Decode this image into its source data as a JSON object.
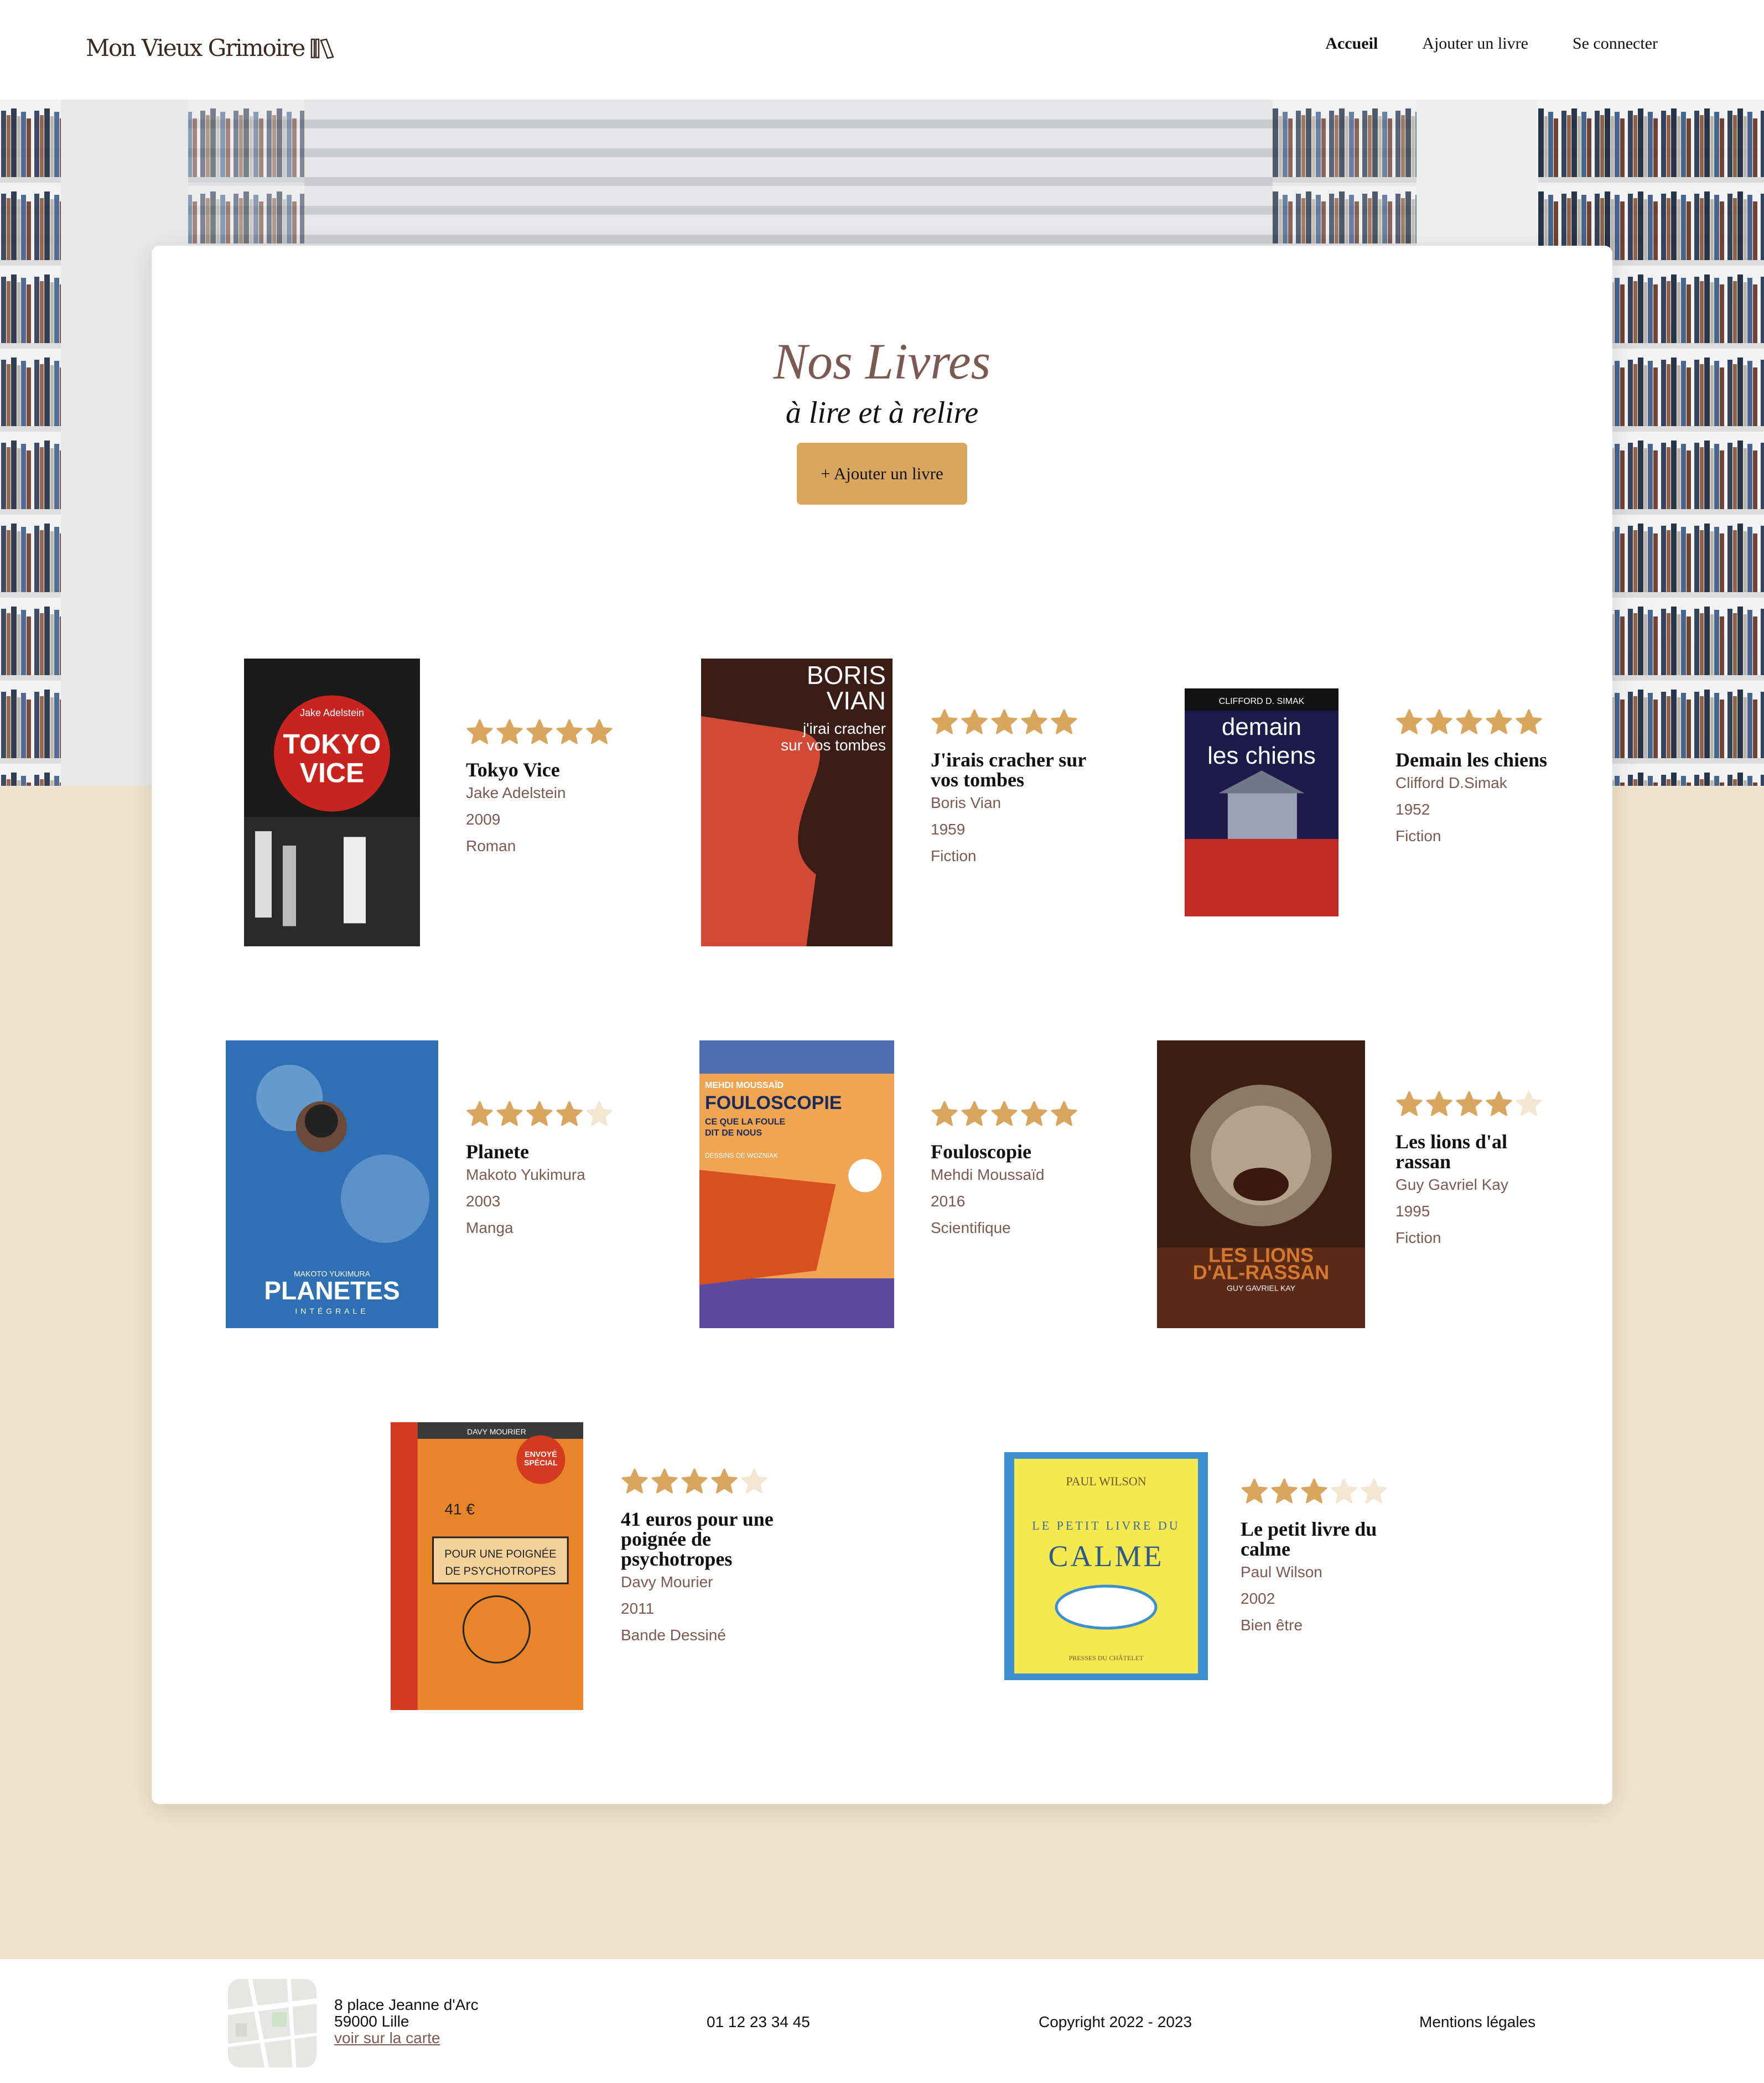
{
  "header": {
    "logo_text": "Mon Vieux Grimoire",
    "nav": [
      "Accueil",
      "Ajouter un livre",
      "Se connecter"
    ]
  },
  "main": {
    "title": "Nos Livres",
    "subtitle": "à lire et à relire",
    "add_button": "+ Ajouter un livre"
  },
  "colors": {
    "accent": "#d9a65f",
    "star_on": "#d9a65f",
    "star_off": "#f3e6d3",
    "muted_text": "#7a5a52",
    "page_bg": "#f1e3cd"
  },
  "books": [
    {
      "title": "Tokyo Vice",
      "author": "Jake Adelstein",
      "year": "2009",
      "genre": "Roman",
      "rating": 5,
      "cover": {
        "bg": "#1a1a1a",
        "accent": "#c9231f",
        "texts": [
          "Jake Adelstein",
          "TOKYO VICE"
        ]
      }
    },
    {
      "title": "J'irais cracher sur vos tombes",
      "author": "Boris Vian",
      "year": "1959",
      "genre": "Fiction",
      "rating": 5,
      "cover": {
        "bg": "#3a1d17",
        "accent": "#d24a35",
        "texts": [
          "BORIS VIAN",
          "j'irai cracher sur vos tombes"
        ]
      }
    },
    {
      "title": "Demain les chiens",
      "author": "Clifford D.Simak",
      "year": "1952",
      "genre": "Fiction",
      "rating": 5,
      "cover": {
        "bg": "#1d1a4a",
        "accent": "#c22a22",
        "texts": [
          "CLIFFORD D. SIMAK",
          "demain les chiens"
        ]
      }
    },
    {
      "title": "Planete",
      "author": "Makoto Yukimura",
      "year": "2003",
      "genre": "Manga",
      "rating": 4,
      "cover": {
        "bg": "#2f6fb3",
        "accent": "#9bc7ea",
        "texts": [
          "MAKOTO YUKIMURA",
          "PLANETES",
          "INTÉGRALE"
        ]
      }
    },
    {
      "title": "Fouloscopie",
      "author": "Mehdi Moussaïd",
      "year": "2016",
      "genre": "Scientifique",
      "rating": 5,
      "cover": {
        "bg": "#f0a552",
        "accent": "#d8501f",
        "texts": [
          "MEHDI MOUSSAÏD",
          "FOULOSCOPIE",
          "CE QUE LA FOULE DIT DE NOUS",
          "DESSINS DE WOZNIAK"
        ]
      }
    },
    {
      "title": "Les lions d'al rassan",
      "author": "Guy Gavriel Kay",
      "year": "1995",
      "genre": "Fiction",
      "rating": 4,
      "cover": {
        "bg": "#3b1d12",
        "accent": "#d4782f",
        "texts": [
          "LES LIONS D'AL-RASSAN",
          "GUY GAVRIEL KAY"
        ]
      }
    },
    {
      "title": "41 euros pour une poignée de psychotropes",
      "author": "Davy Mourier",
      "year": "2011",
      "genre": "Bande Dessiné",
      "rating": 4,
      "cover": {
        "bg": "#e8852a",
        "accent": "#d43a1f",
        "texts": [
          "DAVY MOURIER",
          "41 €",
          "POUR UNE POIGNÉE DE PSYCHOTROPES",
          "VU DANS ENVOYÉ SPÉCIAL"
        ]
      }
    },
    {
      "title": "Le petit livre du calme",
      "author": "Paul Wilson",
      "year": "2002",
      "genre": "Bien être",
      "rating": 3,
      "cover": {
        "bg": "#f6e84f",
        "accent": "#3d8fd0",
        "texts": [
          "PAUL WILSON",
          "LE PETIT LIVRE DU",
          "CALME",
          "PRESSES DU CHÂTELET"
        ]
      }
    }
  ],
  "footer": {
    "address_line1": "8 place Jeanne d'Arc",
    "address_line2": "59000 Lille",
    "map_link": "voir sur la carte",
    "phone": "01 12 23 34 45",
    "copyright": "Copyright 2022 - 2023",
    "legal": "Mentions légales"
  }
}
